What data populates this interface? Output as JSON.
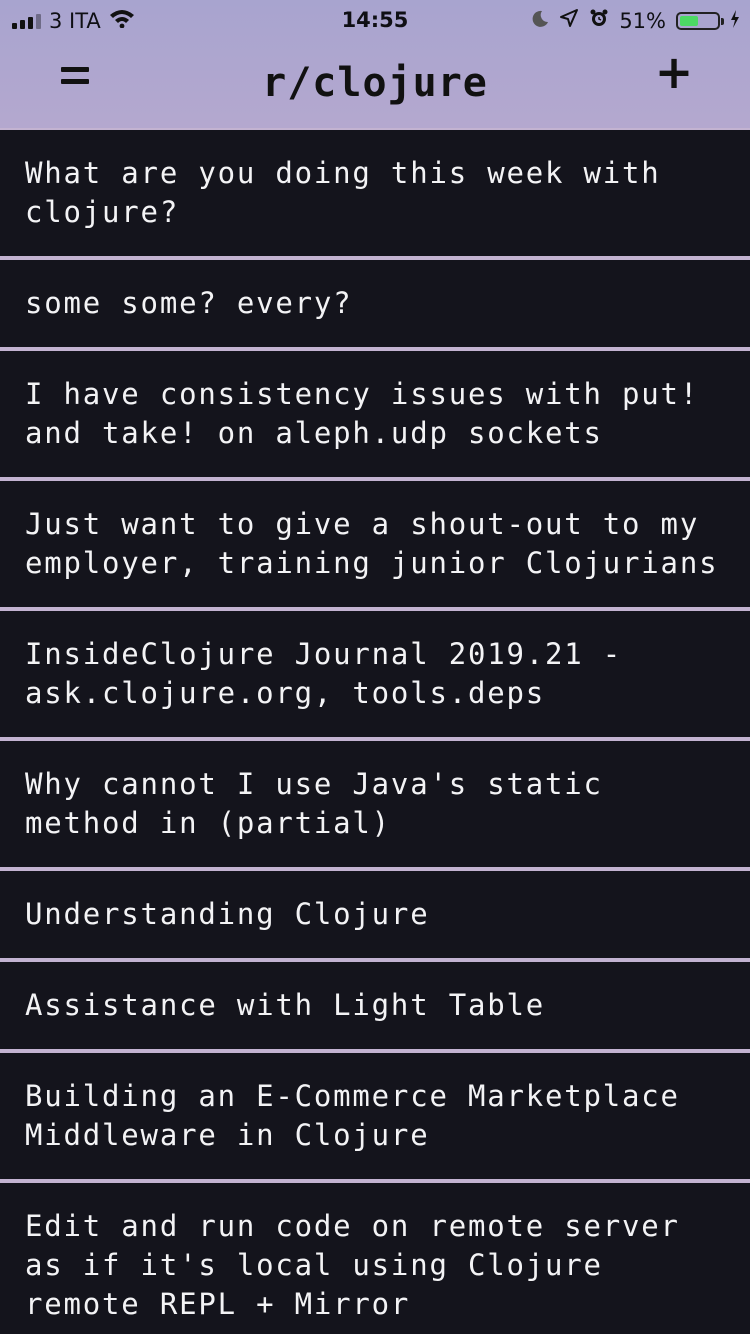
{
  "status_bar": {
    "carrier": "3 ITA",
    "time": "14:55",
    "battery_percent": "51%",
    "battery_level": 0.51,
    "icons": [
      "signal-icon",
      "wifi-icon",
      "moon-icon",
      "location-icon",
      "alarm-icon",
      "battery-icon",
      "charging-icon"
    ]
  },
  "navbar": {
    "title": "r/clojure",
    "menu_icon": "hamburger-icon",
    "add_label": "+"
  },
  "colors": {
    "header": "#aaa5d0",
    "list_bg": "#14141c",
    "separator": "#c3b3d1",
    "text": "#f3f3f5",
    "battery": "#4cd964"
  },
  "posts": [
    {
      "title": "What are you doing this week with clojure?"
    },
    {
      "title": "some some? every?"
    },
    {
      "title": "I have consistency issues with put! and take! on aleph.udp sockets"
    },
    {
      "title": "Just want to give a shout-out to my employer, training junior Clojurians"
    },
    {
      "title": "InsideClojure Journal 2019.21 - ask.clojure.org, tools.deps"
    },
    {
      "title": "Why cannot I use Java's static method in (partial)"
    },
    {
      "title": "Understanding Clojure"
    },
    {
      "title": "Assistance with Light Table"
    },
    {
      "title": "Building an E-Commerce Marketplace Middleware in Clojure"
    },
    {
      "title": "Edit and run code on remote server as if it's local using Clojure remote REPL + Mirror"
    }
  ]
}
